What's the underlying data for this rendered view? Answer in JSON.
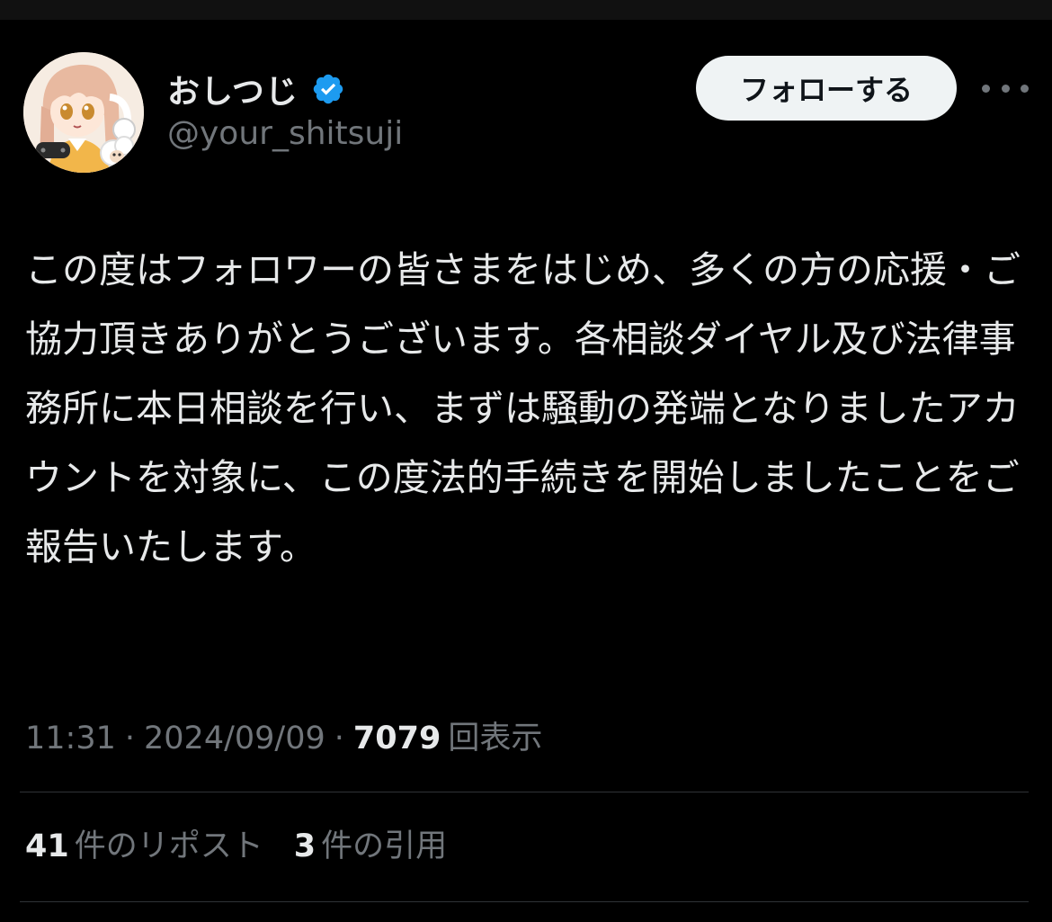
{
  "author": {
    "display_name": "おしつじ",
    "handle": "@your_shitsuji",
    "verified": true,
    "avatar_icon": "anime-character-avatar"
  },
  "actions": {
    "follow_label": "フォローする",
    "more_icon": "more-horizontal-icon"
  },
  "tweet": {
    "text": "この度はフォロワーの皆さまをはじめ、多くの方の応援・ご協力頂きありがとうございます。各相談ダイヤル及び法律事務所に本日相談を行い、まずは騒動の発端となりましたアカウントを対象に、この度法的手続きを開始しましたことをご報告いたします。"
  },
  "meta": {
    "time": "11:31",
    "separator": "·",
    "date": "2024/09/09",
    "views_count": "7079",
    "views_label": "回表示"
  },
  "stats": {
    "reposts_count": "41",
    "reposts_label": "件のリポスト",
    "quotes_count": "3",
    "quotes_label": "件の引用"
  },
  "colors": {
    "background": "#000000",
    "text_primary": "#e7e9ea",
    "text_secondary": "#71767b",
    "verified_blue": "#1d9bf0",
    "follow_button_bg": "#eff3f4",
    "divider": "#2f3336"
  }
}
